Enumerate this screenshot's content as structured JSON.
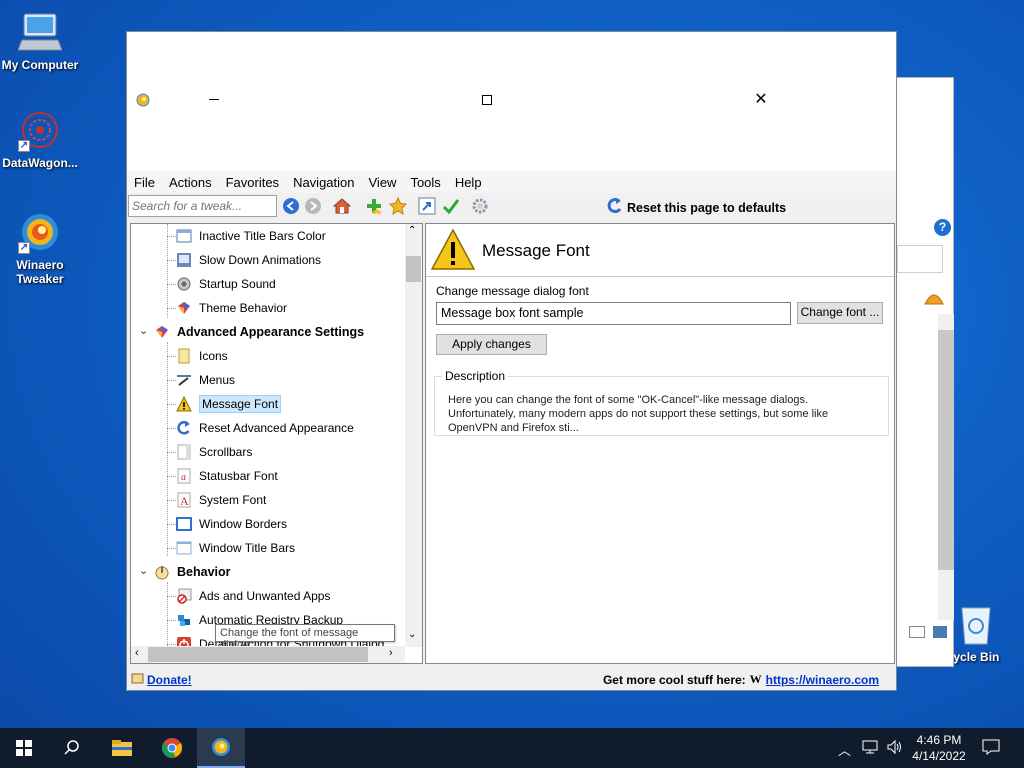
{
  "desktop": {
    "icons": [
      {
        "label": "My Computer"
      },
      {
        "label": "DataWagon..."
      },
      {
        "label": "Winaero Tweaker"
      },
      {
        "label": "ecycle Bin"
      }
    ]
  },
  "menu": [
    "File",
    "Actions",
    "Favorites",
    "Navigation",
    "View",
    "Tools",
    "Help"
  ],
  "toolbar": {
    "search_placeholder": "Search for a tweak...",
    "reset_label": "Reset this page to defaults"
  },
  "tree": {
    "items": [
      {
        "label": "Inactive Title Bars Color",
        "icon": "color-window-icon"
      },
      {
        "label": "Slow Down Animations",
        "icon": "animation-icon"
      },
      {
        "label": "Startup Sound",
        "icon": "speaker-icon"
      },
      {
        "label": "Theme Behavior",
        "icon": "palette-icon"
      },
      {
        "label": "Advanced Appearance Settings",
        "icon": "palette-icon",
        "category": true
      },
      {
        "label": "Icons",
        "icon": "icons-icon"
      },
      {
        "label": "Menus",
        "icon": "menu-icon"
      },
      {
        "label": "Message Font",
        "icon": "warning-icon",
        "selected": true
      },
      {
        "label": "Reset Advanced Appearance",
        "icon": "reset-icon"
      },
      {
        "label": "Scrollbars",
        "icon": "scrollbar-icon"
      },
      {
        "label": "Statusbar Font",
        "icon": "font-icon"
      },
      {
        "label": "System Font",
        "icon": "font-a-icon"
      },
      {
        "label": "Window Borders",
        "icon": "window-border-icon"
      },
      {
        "label": "Window Title Bars",
        "icon": "window-icon"
      },
      {
        "label": "Behavior",
        "icon": "behavior-icon",
        "category": true
      },
      {
        "label": "Ads and Unwanted Apps",
        "icon": "block-icon"
      },
      {
        "label": "Automatic Registry Backup",
        "icon": "registry-icon"
      },
      {
        "label": "Default Action for Shutdown Dialog",
        "icon": "shutdown-icon"
      }
    ],
    "tooltip": "Change the font of message dialog."
  },
  "panel": {
    "title": "Message Font",
    "font_label": "Change message dialog font",
    "font_value": "Message box font sample",
    "change_font_button": "Change font ...",
    "apply_button": "Apply changes",
    "description_title": "Description",
    "description_text": "Here you can change the font of some \"OK-Cancel\"-like message dialogs. Unfortunately, many modern apps do not support these settings, but some like OpenVPN and Firefox sti..."
  },
  "statusbar": {
    "donate": "Donate!",
    "more_label": "Get more cool stuff here:",
    "site": "https://winaero.com"
  },
  "taskbar": {
    "time": "4:46 PM",
    "date": "4/14/2022"
  },
  "colors": {
    "desktop": "#0f5fc4",
    "taskbar": "#101c2c",
    "selection": "#cce8ff",
    "link": "#0033cc"
  }
}
